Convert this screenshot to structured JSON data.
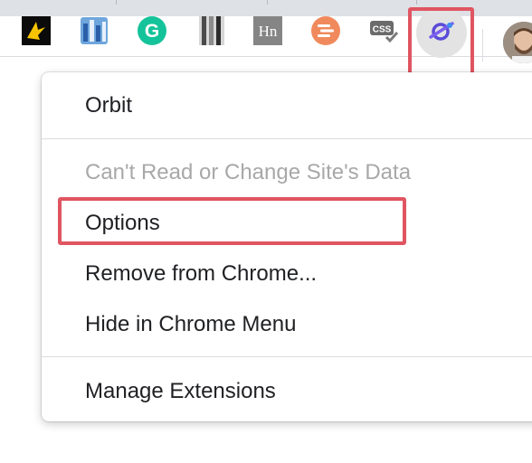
{
  "toolbar": {
    "extensions": [
      {
        "name": "bird-extension-icon"
      },
      {
        "name": "bars-extension-icon"
      },
      {
        "name": "grammarly-icon",
        "glyph": "G"
      },
      {
        "name": "stripes-extension-icon"
      },
      {
        "name": "hacker-news-icon",
        "label": "Hn"
      },
      {
        "name": "lines-orb-icon"
      },
      {
        "name": "css-viewer-icon",
        "label": "CSS"
      },
      {
        "name": "orbit-icon"
      }
    ],
    "avatar": "profile-avatar"
  },
  "menu": {
    "title": "Orbit",
    "items": [
      {
        "label": "Can't Read or Change Site's Data",
        "disabled": true
      },
      {
        "label": "Options",
        "disabled": false
      },
      {
        "label": "Remove from Chrome...",
        "disabled": false
      },
      {
        "label": "Hide in Chrome Menu",
        "disabled": false
      }
    ],
    "manage": "Manage Extensions"
  },
  "colors": {
    "highlight": "#e05561",
    "grammarly": "#15c39a",
    "orbit": "#5a4bd8",
    "disabled_text": "#a8a8a8"
  }
}
